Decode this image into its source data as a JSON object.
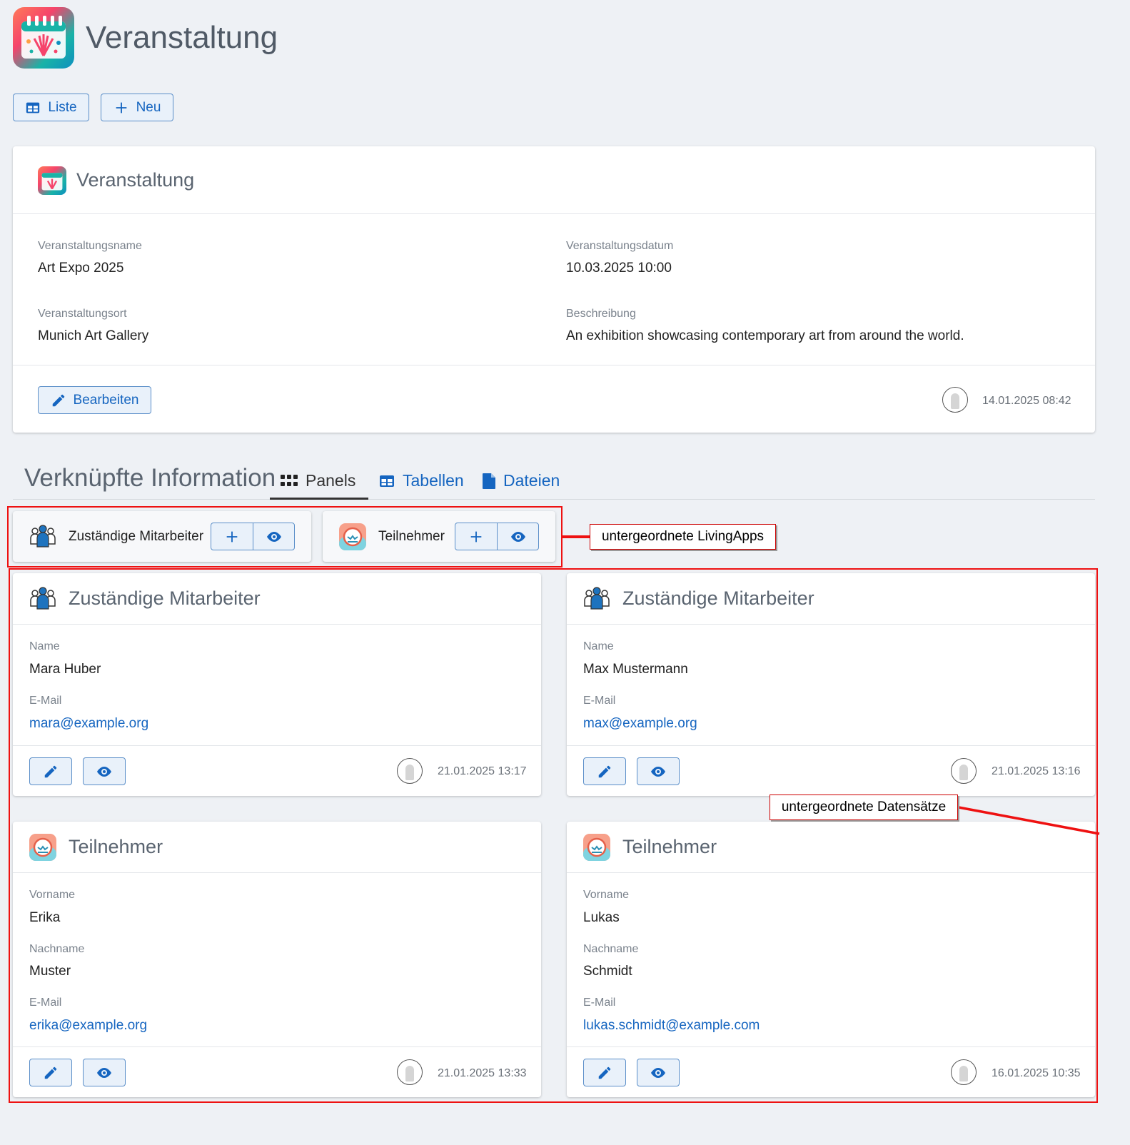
{
  "app": {
    "title": "Veranstaltung",
    "colors": {
      "accent": "#1565c0",
      "annotation": "#e11111",
      "background": "#eef1f5"
    }
  },
  "toolbar": {
    "list_label": "Liste",
    "new_label": "Neu"
  },
  "record": {
    "title": "Veranstaltung",
    "fields": {
      "name_label": "Veranstaltungsname",
      "name_value": "Art Expo 2025",
      "date_label": "Veranstaltungsdatum",
      "date_value": "10.03.2025 10:00",
      "place_label": "Veranstaltungsort",
      "place_value": "Munich Art Gallery",
      "desc_label": "Beschreibung",
      "desc_value": "An exhibition showcasing contemporary art from around the world."
    },
    "edit_label": "Bearbeiten",
    "timestamp": "14.01.2025 08:42"
  },
  "linked": {
    "title": "Verknüpfte Information",
    "tabs": [
      {
        "label": "Panels",
        "icon": "grid-icon",
        "active": true
      },
      {
        "label": "Tabellen",
        "icon": "table-icon",
        "active": false
      },
      {
        "label": "Dateien",
        "icon": "file-icon",
        "active": false
      }
    ],
    "apps": [
      {
        "label": "Zuständige Mitarbeiter",
        "icon": "people-icon"
      },
      {
        "label": "Teilnehmer",
        "icon": "participant-icon"
      }
    ],
    "records": [
      {
        "title": "Zuständige Mitarbeiter",
        "f1_label": "Name",
        "f1_value": "Mara Huber",
        "f2_label": "E-Mail",
        "f2_value": "mara@example.org",
        "timestamp": "21.01.2025 13:17"
      },
      {
        "title": "Zuständige Mitarbeiter",
        "f1_label": "Name",
        "f1_value": "Max Mustermann",
        "f2_label": "E-Mail",
        "f2_value": "max@example.org",
        "timestamp": "21.01.2025 13:16"
      },
      {
        "title": "Teilnehmer",
        "f1_label": "Vorname",
        "f1_value": "Erika",
        "f2_label": "Nachname",
        "f2_value": "Muster",
        "f3_label": "E-Mail",
        "f3_value": "erika@example.org",
        "timestamp": "21.01.2025 13:33"
      },
      {
        "title": "Teilnehmer",
        "f1_label": "Vorname",
        "f1_value": "Lukas",
        "f2_label": "Nachname",
        "f2_value": "Schmidt",
        "f3_label": "E-Mail",
        "f3_value": "lukas.schmidt@example.com",
        "timestamp": "16.01.2025 10:35"
      }
    ]
  },
  "annotations": {
    "apps_callout": "untergeordnete LivingApps",
    "records_callout": "untergeordnete Datensätze"
  }
}
